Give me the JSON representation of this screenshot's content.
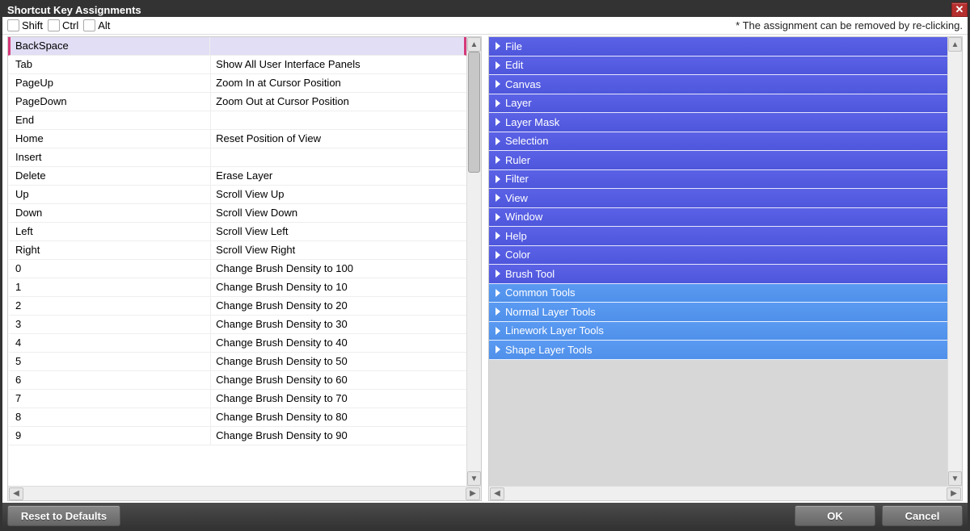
{
  "title": "Shortcut Key Assignments",
  "hint": "* The assignment can be removed by re-clicking.",
  "modifiers": {
    "shift_label": "Shift",
    "ctrl_label": "Ctrl",
    "alt_label": "Alt"
  },
  "selected_key_index": 0,
  "keys": [
    {
      "key": "BackSpace",
      "action": ""
    },
    {
      "key": "Tab",
      "action": "Show All User Interface Panels"
    },
    {
      "key": "PageUp",
      "action": "Zoom In at Cursor Position"
    },
    {
      "key": "PageDown",
      "action": "Zoom Out at Cursor Position"
    },
    {
      "key": "End",
      "action": ""
    },
    {
      "key": "Home",
      "action": "Reset Position of View"
    },
    {
      "key": "Insert",
      "action": ""
    },
    {
      "key": "Delete",
      "action": "Erase Layer"
    },
    {
      "key": "Up",
      "action": "Scroll View Up"
    },
    {
      "key": "Down",
      "action": "Scroll View Down"
    },
    {
      "key": "Left",
      "action": "Scroll View Left"
    },
    {
      "key": "Right",
      "action": "Scroll View Right"
    },
    {
      "key": "0",
      "action": "Change Brush Density to 100"
    },
    {
      "key": "1",
      "action": "Change Brush Density to 10"
    },
    {
      "key": "2",
      "action": "Change Brush Density to 20"
    },
    {
      "key": "3",
      "action": "Change Brush Density to 30"
    },
    {
      "key": "4",
      "action": "Change Brush Density to 40"
    },
    {
      "key": "5",
      "action": "Change Brush Density to 50"
    },
    {
      "key": "6",
      "action": "Change Brush Density to 60"
    },
    {
      "key": "7",
      "action": "Change Brush Density to 70"
    },
    {
      "key": "8",
      "action": "Change Brush Density to 80"
    },
    {
      "key": "9",
      "action": "Change Brush Density to 90"
    }
  ],
  "categories": [
    {
      "label": "File",
      "style": "dark"
    },
    {
      "label": "Edit",
      "style": "dark"
    },
    {
      "label": "Canvas",
      "style": "dark"
    },
    {
      "label": "Layer",
      "style": "dark"
    },
    {
      "label": "Layer Mask",
      "style": "dark"
    },
    {
      "label": "Selection",
      "style": "dark"
    },
    {
      "label": "Ruler",
      "style": "dark"
    },
    {
      "label": "Filter",
      "style": "dark"
    },
    {
      "label": "View",
      "style": "dark"
    },
    {
      "label": "Window",
      "style": "dark"
    },
    {
      "label": "Help",
      "style": "dark"
    },
    {
      "label": "Color",
      "style": "dark"
    },
    {
      "label": "Brush Tool",
      "style": "dark"
    },
    {
      "label": "Common Tools",
      "style": "light"
    },
    {
      "label": "Normal Layer Tools",
      "style": "light"
    },
    {
      "label": "Linework Layer Tools",
      "style": "light"
    },
    {
      "label": "Shape Layer Tools",
      "style": "light"
    }
  ],
  "buttons": {
    "reset": "Reset to Defaults",
    "ok": "OK",
    "cancel": "Cancel"
  }
}
